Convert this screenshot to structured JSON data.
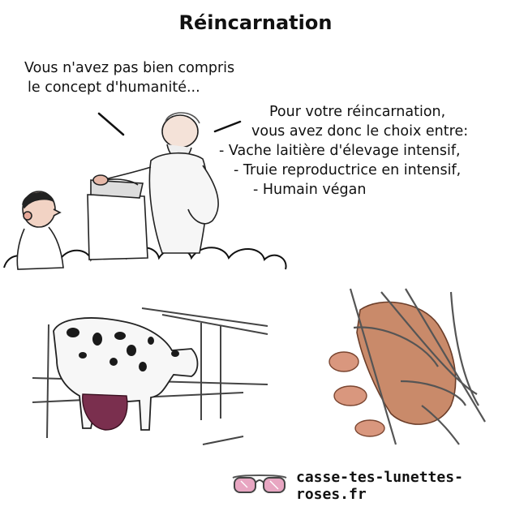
{
  "title": "Réincarnation",
  "speech_left": {
    "line1": "Vous n'avez pas bien compris",
    "line2": "le concept d'humanité..."
  },
  "speech_right": {
    "line1": "Pour votre réincarnation,",
    "line2": "vous avez donc le choix entre:",
    "line3": "- Vache laitière d'élevage intensif,",
    "line4": "- Truie reproductrice en intensif,",
    "line5": "- Humain végan"
  },
  "footer": {
    "site": "casse-tes-lunettes-roses.fr",
    "icon": "pink-glasses-icon"
  },
  "colors": {
    "ink": "#111111",
    "udder": "#7a2f4e",
    "pig": "#c98a6a",
    "glasses": "#e8a6c2"
  }
}
